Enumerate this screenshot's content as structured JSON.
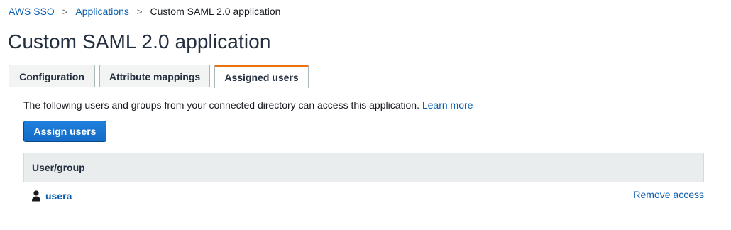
{
  "breadcrumb": {
    "items": [
      {
        "label": "AWS SSO"
      },
      {
        "label": "Applications"
      }
    ],
    "current": "Custom SAML 2.0 application",
    "separator": ">"
  },
  "page": {
    "title": "Custom SAML 2.0 application"
  },
  "tabs": [
    {
      "label": "Configuration",
      "active": false
    },
    {
      "label": "Attribute mappings",
      "active": false
    },
    {
      "label": "Assigned users",
      "active": true
    }
  ],
  "assigned": {
    "description": "The following users and groups from your connected directory can access this application.",
    "learn_more": "Learn more",
    "assign_button": "Assign users",
    "table": {
      "column": "User/group",
      "rows": [
        {
          "name": "usera",
          "icon": "user-icon",
          "action": "Remove access"
        }
      ]
    }
  },
  "colors": {
    "link": "#0a5eb0",
    "active_tab_accent": "#ec7211",
    "primary_button": "#1a75d2",
    "header_bg": "#eaeded"
  }
}
